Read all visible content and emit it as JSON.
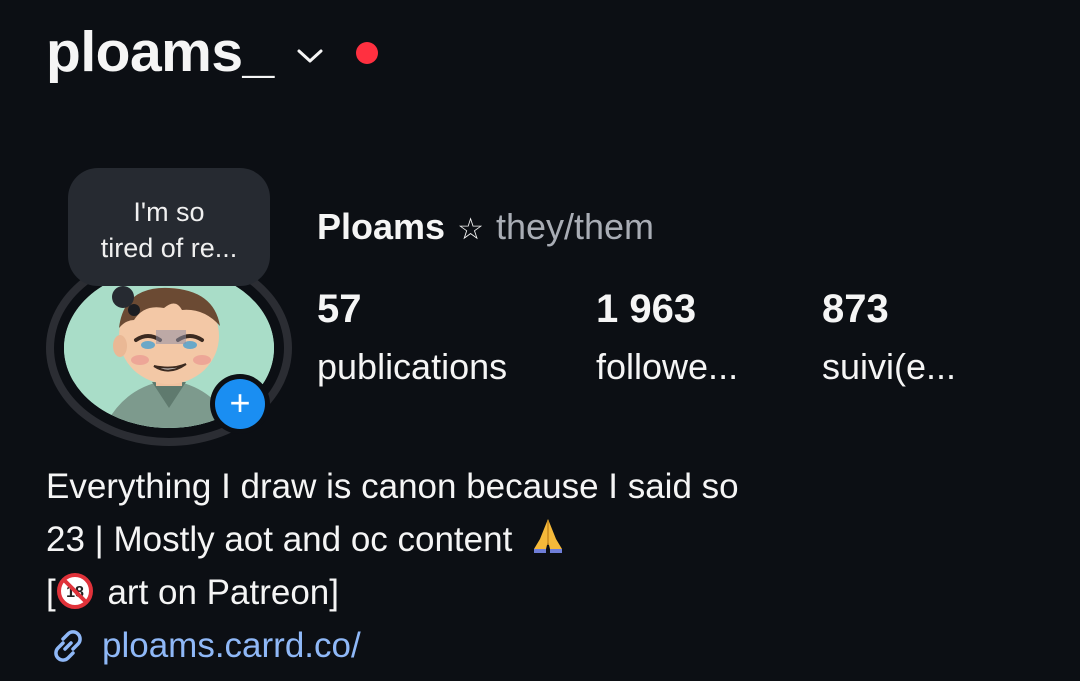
{
  "header": {
    "username": "ploams_",
    "dropdown_icon": "chevron-down-icon",
    "live_indicator_color": "#ff3040"
  },
  "note": {
    "line1": "I'm so",
    "line2": "tired of re..."
  },
  "profile": {
    "display_name": "Ploams",
    "star_symbol": "☆",
    "pronouns": "they/them"
  },
  "stats": [
    {
      "value": "57",
      "label": "publications"
    },
    {
      "value": "1 963",
      "label": "followe..."
    },
    {
      "value": "873",
      "label": "suivi(e..."
    }
  ],
  "bio": {
    "line1": "Everything I draw is canon because I said so",
    "line2": "23 | Mostly aot and oc content",
    "line3_prefix": "[",
    "line3_suffix": " art on Patreon]",
    "link": "ploams.carrd.co/"
  },
  "colors": {
    "background": "#0c0f14",
    "accent_blue": "#1a8ef2",
    "link": "#8fb8f7",
    "muted": "#a9adb5"
  }
}
